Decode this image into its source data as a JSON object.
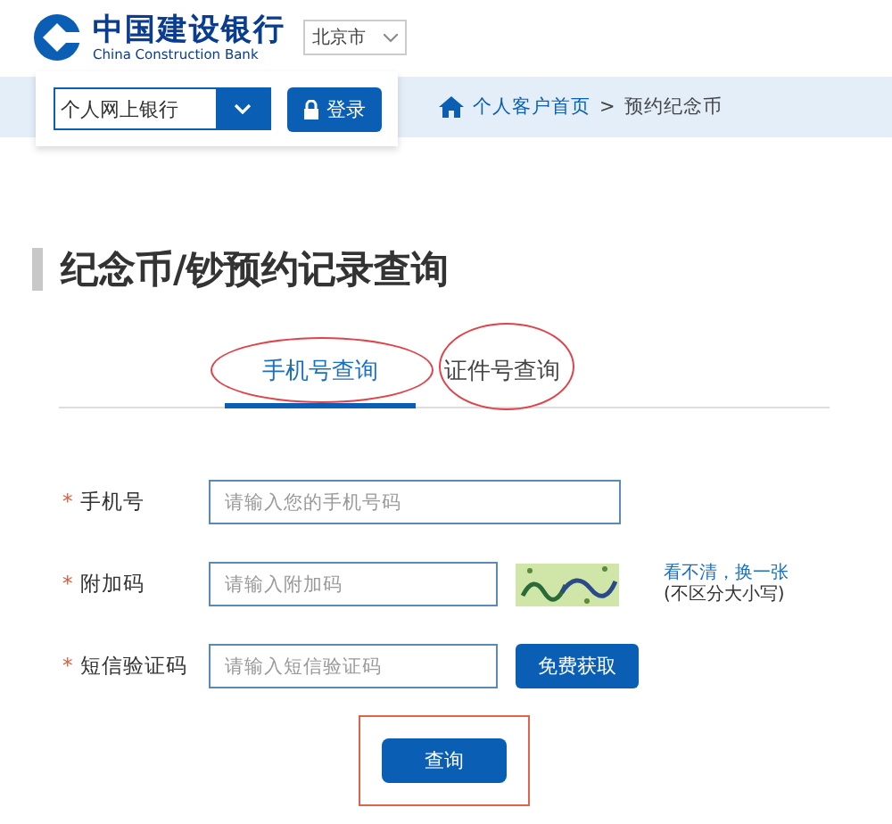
{
  "header": {
    "logo_cn": "中国建设银行",
    "logo_en": "China Construction Bank",
    "city": "北京市"
  },
  "nav": {
    "bank_select": "个人网上银行",
    "login": "登录",
    "breadcrumb": [
      {
        "label": "个人客户首页",
        "link": true
      },
      {
        "label": ">",
        "link": false
      },
      {
        "label": "预约纪念币",
        "link": false
      }
    ]
  },
  "title": "纪念币/钞预约记录查询",
  "tabs": [
    {
      "label": "手机号查询",
      "selected": true,
      "circled": true
    },
    {
      "label": "证件号查询",
      "selected": false,
      "circled": true
    }
  ],
  "form": {
    "rows": [
      {
        "kind": "text",
        "required": "*",
        "label": "手机号",
        "placeholder": "请输入您的手机号码"
      },
      {
        "kind": "captcha",
        "required": "*",
        "label": "附加码",
        "placeholder": "请输入附加码",
        "refresh": "看不清，换一张",
        "hint": "(不区分大小写)"
      },
      {
        "kind": "sms",
        "required": "*",
        "label": "短信验证码",
        "placeholder": "请输入短信验证码",
        "button": "免费获取"
      }
    ],
    "submit": "查询",
    "submit_boxed": true
  }
}
